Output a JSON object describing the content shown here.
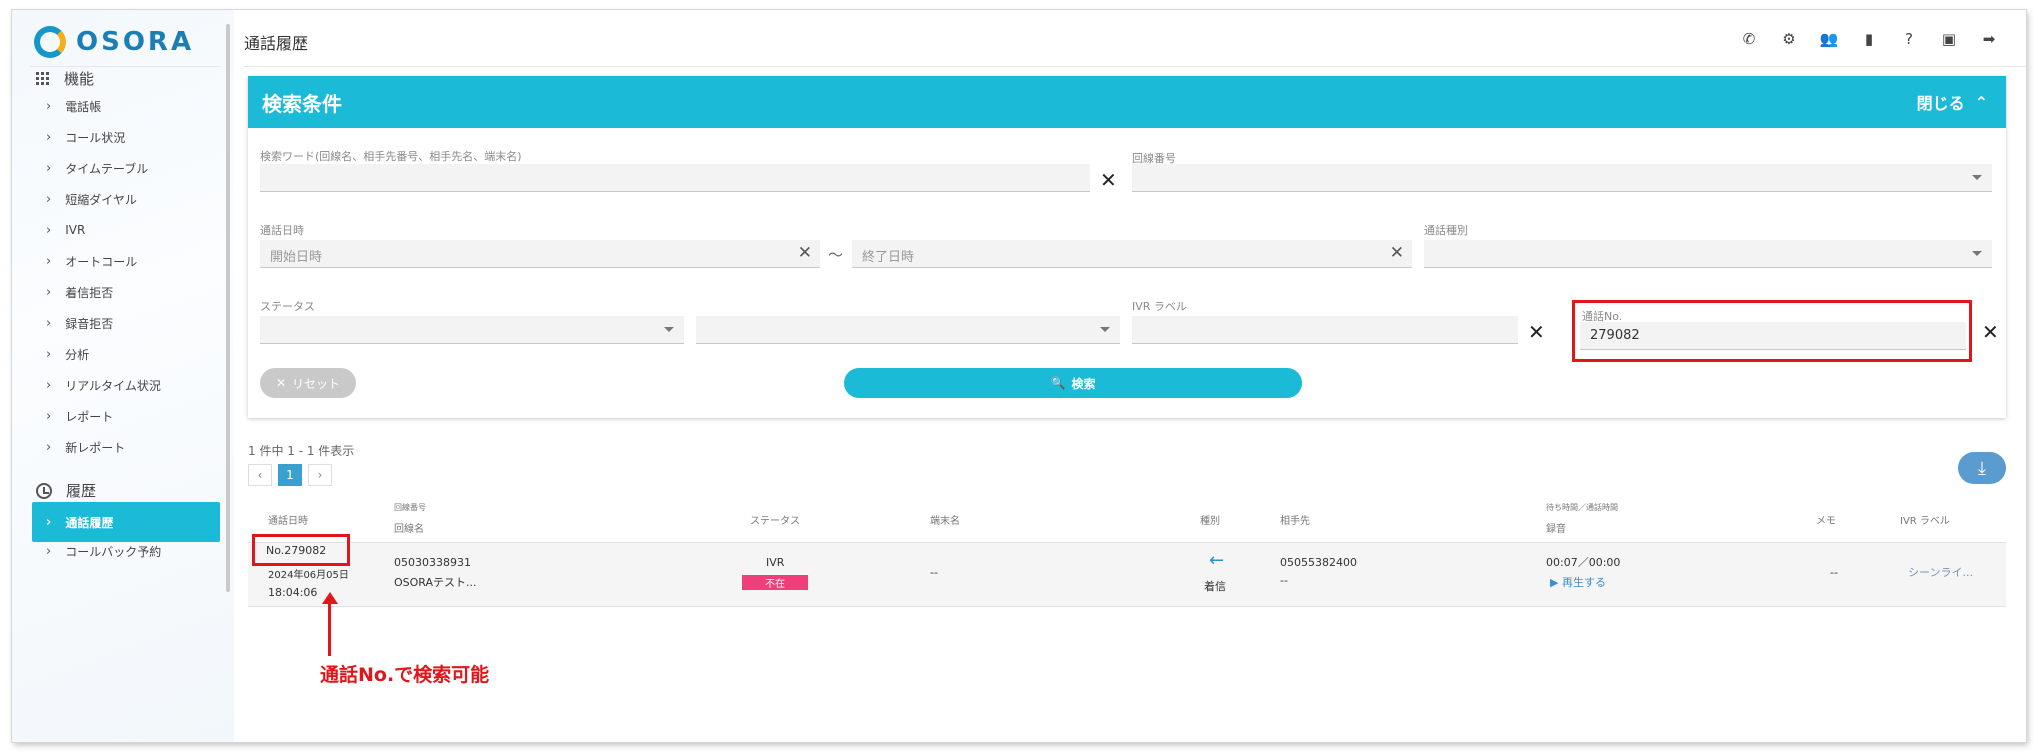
{
  "app": {
    "logo_text": "OSORA"
  },
  "header": {
    "title": "通話履歴",
    "icons": [
      "phone-callback-icon",
      "settings-icon",
      "users-icon",
      "book-icon",
      "help-icon",
      "account-box-icon",
      "logout-icon"
    ]
  },
  "sidebar": {
    "section_features": "機能",
    "items": [
      {
        "label": "電話帳"
      },
      {
        "label": "コール状況"
      },
      {
        "label": "タイムテーブル"
      },
      {
        "label": "短縮ダイヤル"
      },
      {
        "label": "IVR"
      },
      {
        "label": "オートコール"
      },
      {
        "label": "着信拒否"
      },
      {
        "label": "録音拒否"
      },
      {
        "label": "分析"
      },
      {
        "label": "リアルタイム状況"
      },
      {
        "label": "レポート"
      },
      {
        "label": "新レポート"
      }
    ],
    "section_history": "履歴",
    "history_items": [
      {
        "label": "通話履歴",
        "active": true
      },
      {
        "label": "コールバック予約"
      }
    ]
  },
  "search": {
    "title": "検索条件",
    "close_label": "閉じる",
    "keyword_label": "検索ワード(回線名、相手先番号、相手先名、端末名)",
    "keyword_value": "",
    "line_number_label": "回線番号",
    "date_label": "通話日時",
    "start_placeholder": "開始日時",
    "end_placeholder": "終了日時",
    "range_separator": "〜",
    "call_type_label": "通話種別",
    "status_label": "ステータス",
    "ivr_label": "IVR ラベル",
    "call_no_label": "通話No.",
    "call_no_value": "279082",
    "reset_label": "リセット",
    "search_label": "検索"
  },
  "results": {
    "summary": "1 件中 1 - 1 件表示",
    "pager": {
      "prev": "‹",
      "current": "1",
      "next": "›"
    },
    "columns": {
      "datetime": "通話日時",
      "line_number": "回線番号",
      "line_name": "回線名",
      "status": "ステータス",
      "terminal": "端末名",
      "type": "種別",
      "partner": "相手先",
      "duration": "待ち時間／通話時間",
      "recording": "録音",
      "memo": "メモ",
      "ivr": "IVR ラベル"
    },
    "rows": [
      {
        "call_no": "No.279082",
        "date": "2024年06月05日",
        "time": "18:04:06",
        "line_number": "05030338931",
        "line_name": "OSORAテスト...",
        "status_top": "IVR",
        "status_badge": "不在",
        "terminal": "--",
        "direction": "着信",
        "partner_number": "05055382400",
        "partner_name": "--",
        "duration": "00:07／00:00",
        "play_label": "▶ 再生する",
        "memo": "--",
        "ivr_label": "シーンライ..."
      }
    ]
  },
  "annotation": {
    "text": "通話No.で検索可能"
  },
  "colors": {
    "accent": "#1bbad6",
    "annotation": "#e0161b",
    "badge": "#ef3f7a"
  }
}
